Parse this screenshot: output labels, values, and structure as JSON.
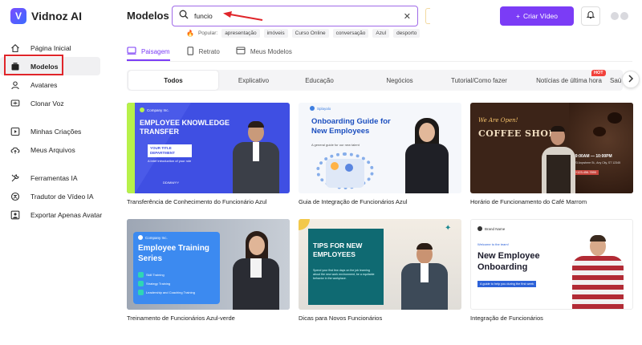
{
  "app": {
    "name": "Vidnoz AI",
    "logo_letter": "V"
  },
  "sidebar": {
    "items": [
      {
        "label": "Página Inicial",
        "icon": "home-icon"
      },
      {
        "label": "Modelos",
        "icon": "templates-icon",
        "active": true
      },
      {
        "label": "Avatares",
        "icon": "avatar-icon"
      },
      {
        "label": "Clonar Voz",
        "icon": "voice-clone-icon"
      },
      {
        "label": "Minhas Criações",
        "icon": "play-icon"
      },
      {
        "label": "Meus Arquivos",
        "icon": "cloud-upload-icon"
      },
      {
        "label": "Ferramentas IA",
        "icon": "tools-icon"
      },
      {
        "label": "Tradutor de Vídeo IA",
        "icon": "translate-icon"
      },
      {
        "label": "Exportar Apenas Avatar",
        "icon": "export-avatar-icon"
      }
    ]
  },
  "header": {
    "title": "Modelos",
    "search_value": "funcio",
    "clear_symbol": "✕",
    "create_label": "Criar Vídeo",
    "create_symbol": "+"
  },
  "popular": {
    "label": "Popular:",
    "tags": [
      "apresentação",
      "imóveis",
      "Curso Online",
      "conversação",
      "Azul",
      "desporto"
    ]
  },
  "format_tabs": [
    {
      "label": "Paisagem",
      "icon": "landscape-icon",
      "active": true
    },
    {
      "label": "Retrato",
      "icon": "portrait-icon"
    },
    {
      "label": "Meus Modelos",
      "icon": "my-templates-icon"
    }
  ],
  "categories": [
    "Todos",
    "Explicativo",
    "Educação",
    "Negócios",
    "Tutorial/Como fazer",
    "Notícias de última hora",
    "Saú"
  ],
  "categories_active": "Todos",
  "hot_badge": "HOT",
  "cards": [
    {
      "caption": "Transferência de Conhecimento do Funcionário Azul",
      "brand": "Company Inc.",
      "headline": "EMPLOYEE KNOWLEDGE TRANSFER",
      "sub": "YOUR TITLE DEPARTMENT",
      "line": "A brief introduction of your role",
      "date": "DD/MM/YY"
    },
    {
      "caption": "Guia de Integração de Funcionários Azul",
      "brand": "Splayalo",
      "headline": "Onboarding Guide for New Employees",
      "line": "A general guide for our new talent"
    },
    {
      "caption": "Horário de Funcionamento do Café Marrom",
      "script": "We Are Open!",
      "headline": "COFFEE SHOP",
      "hours": "09:00AM — 10:00PM",
      "address": "123 Anywhere St., Any City, ST 12345",
      "phone": "+123-456-7890"
    },
    {
      "caption": "Treinamento de Funcionários Azul-verde",
      "brand": "Company Inc.",
      "headline": "Employee Training Series",
      "steps": [
        "Skill Training",
        "Strategy Training",
        "Leadership and Coaching Training"
      ]
    },
    {
      "caption": "Dicas para Novos Funcionários",
      "headline": "TIPS FOR NEW EMPLOYEES",
      "line": "Spend your first few days on the job learning about the new work environment, be a equitable behavior in the workplace."
    },
    {
      "caption": "Integração de Funcionários",
      "brand": "Brand Name",
      "welcome": "Welcome to the team!",
      "headline": "New Employee Onboarding",
      "line": "A guide to help you during the first week"
    }
  ]
}
